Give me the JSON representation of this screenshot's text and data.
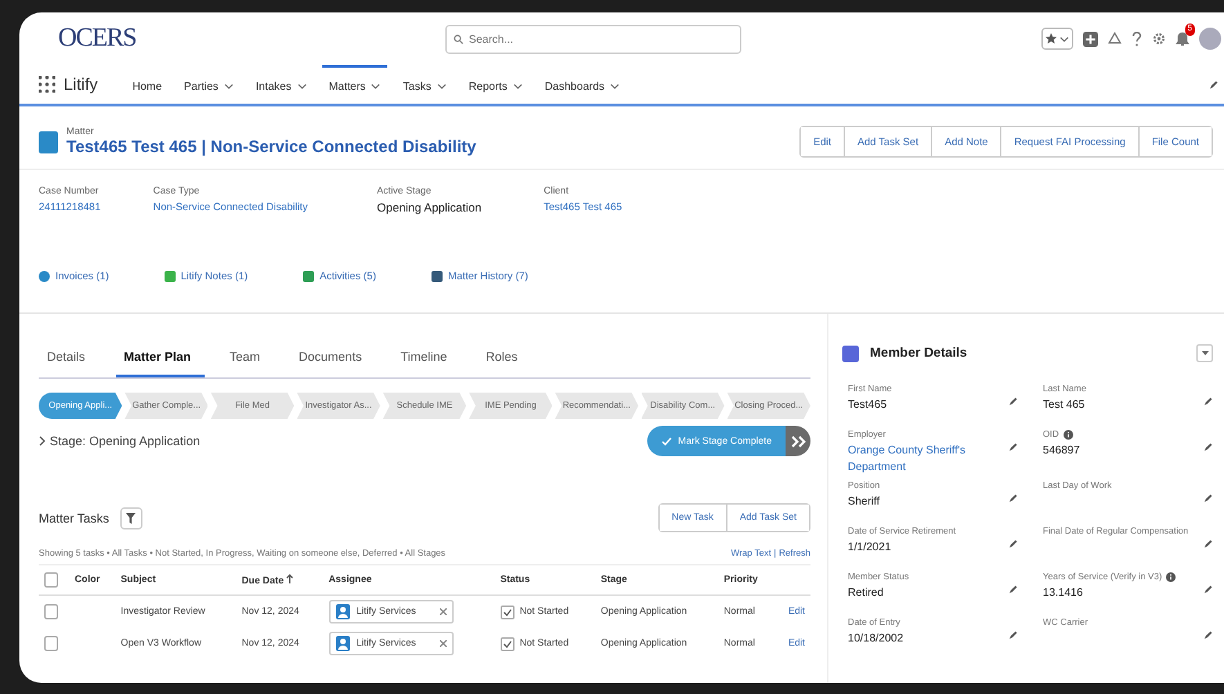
{
  "header": {
    "logo": "OCERS",
    "search": {
      "placeholder": "Search..."
    },
    "notification_count": "5"
  },
  "nav": {
    "app_name": "Litify",
    "items": [
      {
        "label": "Home",
        "dropdown": false,
        "selected": false
      },
      {
        "label": "Parties",
        "dropdown": true,
        "selected": false
      },
      {
        "label": "Intakes",
        "dropdown": true,
        "selected": false
      },
      {
        "label": "Matters",
        "dropdown": true,
        "selected": true
      },
      {
        "label": "Tasks",
        "dropdown": true,
        "selected": false
      },
      {
        "label": "Reports",
        "dropdown": true,
        "selected": false
      },
      {
        "label": "Dashboards",
        "dropdown": true,
        "selected": false
      }
    ]
  },
  "matter": {
    "label": "Matter",
    "title": "Test465 Test 465 | Non-Service Connected Disability",
    "actions": [
      "Edit",
      "Add Task Set",
      "Add Note",
      "Request FAI Processing",
      "File Count"
    ],
    "fields": [
      {
        "label": "Case Number",
        "value": "24111218481",
        "link": true
      },
      {
        "label": "Case Type",
        "value": "Non-Service Connected Disability",
        "link": true
      },
      {
        "label": "Active Stage",
        "value": "Opening Application",
        "link": false
      },
      {
        "label": "Client",
        "value": "Test465 Test 465",
        "link": true
      }
    ],
    "related": [
      {
        "kind": "invoices",
        "label": "Invoices (1)"
      },
      {
        "kind": "notes",
        "label": "Litify Notes (1)"
      },
      {
        "kind": "activities",
        "label": "Activities (5)"
      },
      {
        "kind": "history",
        "label": "Matter History (7)"
      }
    ]
  },
  "tabs": [
    {
      "label": "Details",
      "selected": false
    },
    {
      "label": "Matter Plan",
      "selected": true
    },
    {
      "label": "Team",
      "selected": false
    },
    {
      "label": "Documents",
      "selected": false
    },
    {
      "label": "Timeline",
      "selected": false
    },
    {
      "label": "Roles",
      "selected": false
    }
  ],
  "stages": [
    {
      "label": "Opening Appli...",
      "selected": true
    },
    {
      "label": "Gather Comple...",
      "selected": false
    },
    {
      "label": "File Med",
      "selected": false
    },
    {
      "label": "Investigator As...",
      "selected": false
    },
    {
      "label": "Schedule IME",
      "selected": false
    },
    {
      "label": "IME Pending",
      "selected": false
    },
    {
      "label": "Recommendati...",
      "selected": false
    },
    {
      "label": "Disability Com...",
      "selected": false
    },
    {
      "label": "Closing Proced...",
      "selected": false
    }
  ],
  "stage_toggle": "Stage: Opening Application",
  "mark_complete": "Mark Stage Complete",
  "tasks": {
    "title": "Matter Tasks",
    "buttons": [
      "New Task",
      "Add Task Set"
    ],
    "all_selected": false,
    "summary": "Showing 5 tasks • All Tasks • Not Started, In Progress, Waiting on someone else, Deferred • All Stages",
    "links": [
      "Wrap Text",
      "Refresh"
    ],
    "link_separator": "|",
    "columns": [
      {
        "label": "Color",
        "sorted": false
      },
      {
        "label": "Subject",
        "sorted": false
      },
      {
        "label": "Due Date",
        "sorted": true
      },
      {
        "label": "Assignee",
        "sorted": false
      },
      {
        "label": "Status",
        "sorted": false
      },
      {
        "label": "Stage",
        "sorted": false
      },
      {
        "label": "Priority",
        "sorted": false
      }
    ],
    "rows": [
      {
        "checked": false,
        "subject": "Investigator Review",
        "due": "Nov 12, 2024",
        "assignee": "Litify Services",
        "status": "Not Started",
        "stage": "Opening Application",
        "priority": "Normal",
        "action": "Edit"
      },
      {
        "checked": false,
        "subject": "Open V3 Workflow",
        "due": "Nov 12, 2024",
        "assignee": "Litify Services",
        "status": "Not Started",
        "stage": "Opening Application",
        "priority": "Normal",
        "action": "Edit"
      }
    ]
  },
  "member": {
    "title": "Member Details",
    "fields": [
      {
        "label": "First Name",
        "value": "Test465",
        "link": false,
        "info": false
      },
      {
        "label": "Last Name",
        "value": "Test 465",
        "link": false,
        "info": false
      },
      {
        "label": "Employer",
        "value": "Orange County Sheriff's Department",
        "link": true,
        "info": false
      },
      {
        "label": "OID",
        "value": "546897",
        "link": false,
        "info": true
      },
      {
        "label": "Position",
        "value": "Sheriff",
        "link": false,
        "info": false
      },
      {
        "label": "Last Day of Work",
        "info": false
      },
      {
        "label": "Date of Service Retirement",
        "value": "1/1/2021",
        "link": false,
        "info": false
      },
      {
        "label": "Final Date of Regular Compensation",
        "info": false
      },
      {
        "label": "Member Status",
        "value": "Retired",
        "link": false,
        "info": false
      },
      {
        "label": "Years of Service (Verify in V3)",
        "value": "13.1416",
        "link": false,
        "info": true
      },
      {
        "label": "Date of Entry",
        "value": "10/18/2002",
        "link": false,
        "info": false
      },
      {
        "label": "WC Carrier",
        "info": false
      }
    ]
  }
}
